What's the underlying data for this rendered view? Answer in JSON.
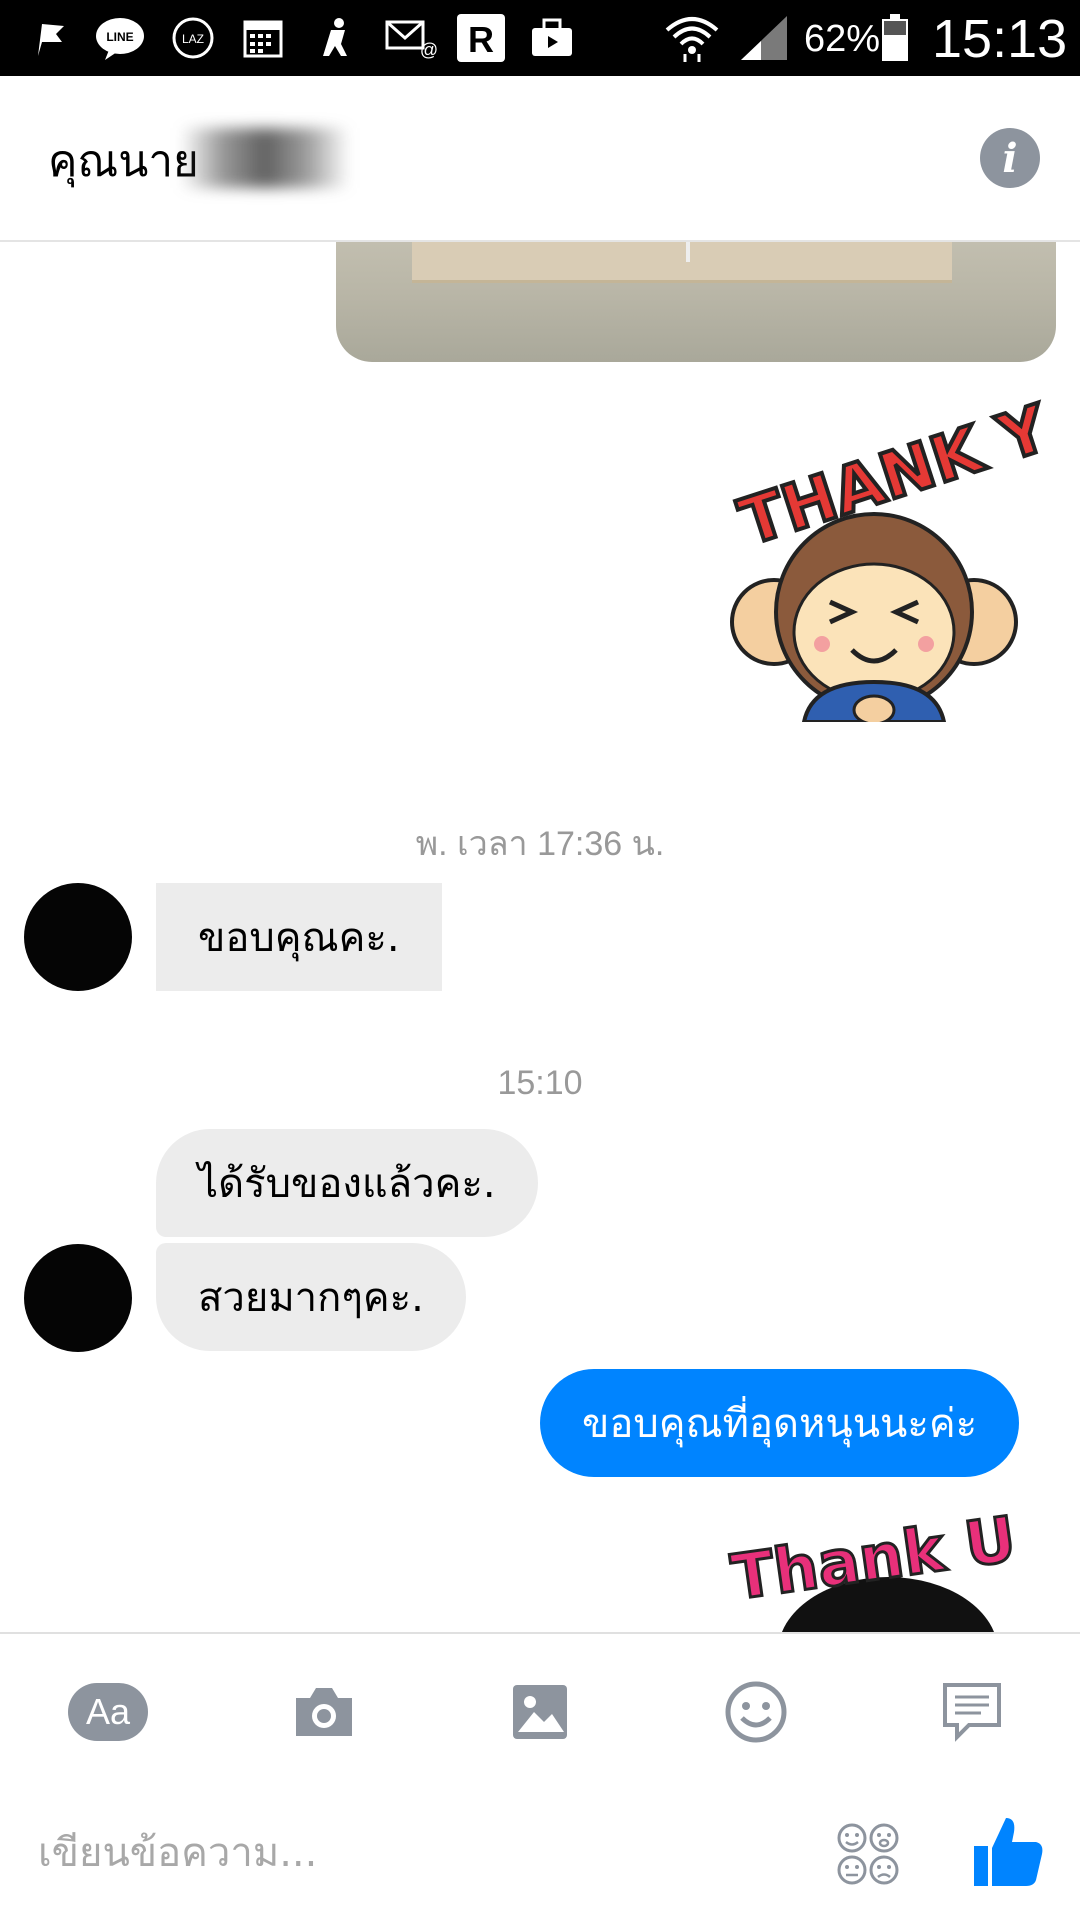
{
  "status_bar": {
    "battery_percent": "62%",
    "clock": "15:13",
    "icons": [
      "flag-icon",
      "line-icon",
      "lazada-icon",
      "calendar-icon",
      "accessibility-icon",
      "email-icon",
      "r-app-icon",
      "briefcase-icon",
      "wifi-icon",
      "signal-icon",
      "battery-icon"
    ]
  },
  "header": {
    "contact_name": "คุณนาย",
    "info_icon": "i"
  },
  "chat": {
    "messages": [
      {
        "type": "photo",
        "direction": "outgoing"
      },
      {
        "type": "sticker",
        "direction": "outgoing",
        "text": "THANK YOU"
      },
      {
        "type": "timestamp",
        "text": "พ. เวลา 17:36 น."
      },
      {
        "type": "text",
        "direction": "incoming",
        "text": "ขอบคุณคะ."
      },
      {
        "type": "timestamp",
        "text": "15:10"
      },
      {
        "type": "text",
        "direction": "incoming",
        "text": "ได้รับของแล้วคะ."
      },
      {
        "type": "text",
        "direction": "incoming",
        "text": "สวยมากๆคะ."
      },
      {
        "type": "text",
        "direction": "outgoing",
        "text": "ขอบคุณที่อุดหนุนนะค่ะ"
      },
      {
        "type": "sticker",
        "direction": "outgoing",
        "text": "Thank U"
      }
    ]
  },
  "toolbar": {
    "text_mode_label": "Aa",
    "items": [
      "text-mode-icon",
      "camera-icon",
      "gallery-icon",
      "emoji-icon",
      "quick-reply-icon"
    ]
  },
  "composer": {
    "placeholder": "เขียนข้อความ...",
    "value": ""
  },
  "colors": {
    "outgoing_bubble": "#0084ff",
    "incoming_bubble": "#ececec",
    "icon_gray": "#8d949e",
    "like_blue": "#0084ff"
  }
}
